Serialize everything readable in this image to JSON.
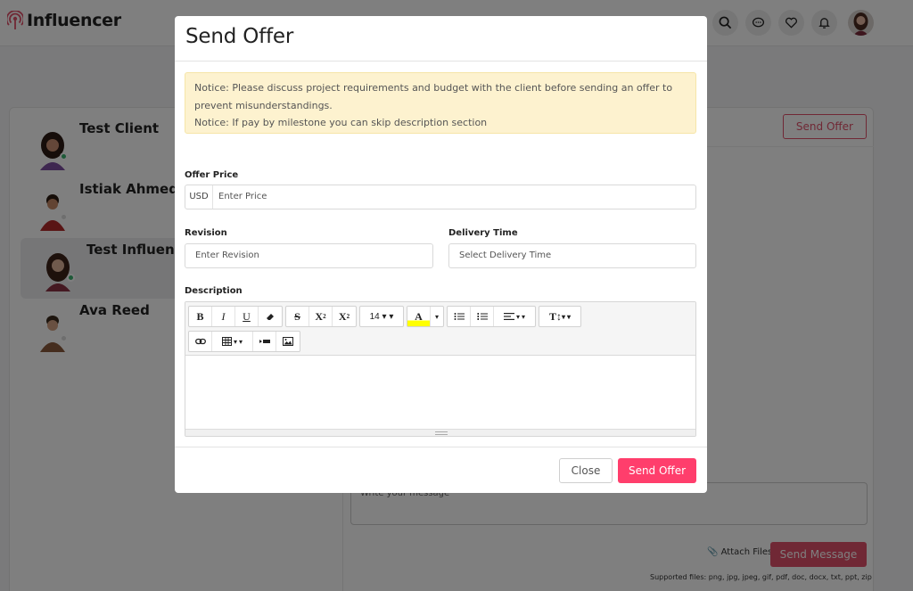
{
  "brand": {
    "name": "Influencer"
  },
  "header_icons": [
    "search-icon",
    "chat-icon",
    "heart-icon",
    "bell-icon"
  ],
  "contacts": [
    {
      "name": "Test Client",
      "online": true
    },
    {
      "name": "Istiak Ahmed",
      "online": false
    },
    {
      "name": "Test Influencer",
      "online": true,
      "active": true
    },
    {
      "name": "Ava Reed",
      "online": false
    }
  ],
  "chat": {
    "send_offer_label": "Send Offer",
    "message_placeholder": "Write your message",
    "attach_label": "Attach Files",
    "send_message_label": "Send Message",
    "supported_files": "Supported files: png, jpg, jpeg, gif, pdf, doc, docx, txt, ppt, zip"
  },
  "modal": {
    "title": "Send Offer",
    "notice_line1": "Notice: Please discuss project requirements and budget with the client before sending an offer to prevent misunderstandings.",
    "notice_line2": "Notice: If pay by milestone you can skip description section",
    "offer_price_label": "Offer Price",
    "currency": "USD",
    "price_placeholder": "Enter Price",
    "revision_label": "Revision",
    "revision_placeholder": "Enter Revision",
    "delivery_label": "Delivery Time",
    "delivery_placeholder": "Select Delivery Time",
    "description_label": "Description",
    "font_size": "14",
    "close_label": "Close",
    "send_label": "Send Offer"
  },
  "colors": {
    "accent": "#ff3e6c",
    "accent_muted": "#e0516a",
    "notice_bg": "#fdf2cf",
    "online": "#3cb371"
  }
}
